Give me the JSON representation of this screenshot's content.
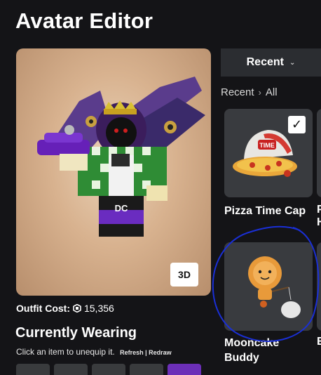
{
  "page": {
    "title": "Avatar Editor"
  },
  "preview": {
    "view_mode_button": "3D"
  },
  "outfit": {
    "cost_label": "Outfit Cost:",
    "cost_value": "15,356",
    "currency_icon": "robux-icon"
  },
  "currently_wearing": {
    "heading": "Currently Wearing",
    "hint": "Click an item to unequip it.",
    "refresh_label": "Refresh",
    "separator": "|",
    "redraw_label": "Redraw"
  },
  "catalog": {
    "category_dropdown": "Recent",
    "breadcrumb": [
      "Recent",
      "All"
    ],
    "items": [
      {
        "name": "Pizza Time Cap",
        "selected": true
      },
      {
        "name": "Mooncake Buddy",
        "selected": false
      }
    ],
    "partial_items": [
      {
        "name": "P H"
      },
      {
        "name": "E"
      }
    ]
  },
  "annotation": {
    "color": "#1a2fd6"
  }
}
